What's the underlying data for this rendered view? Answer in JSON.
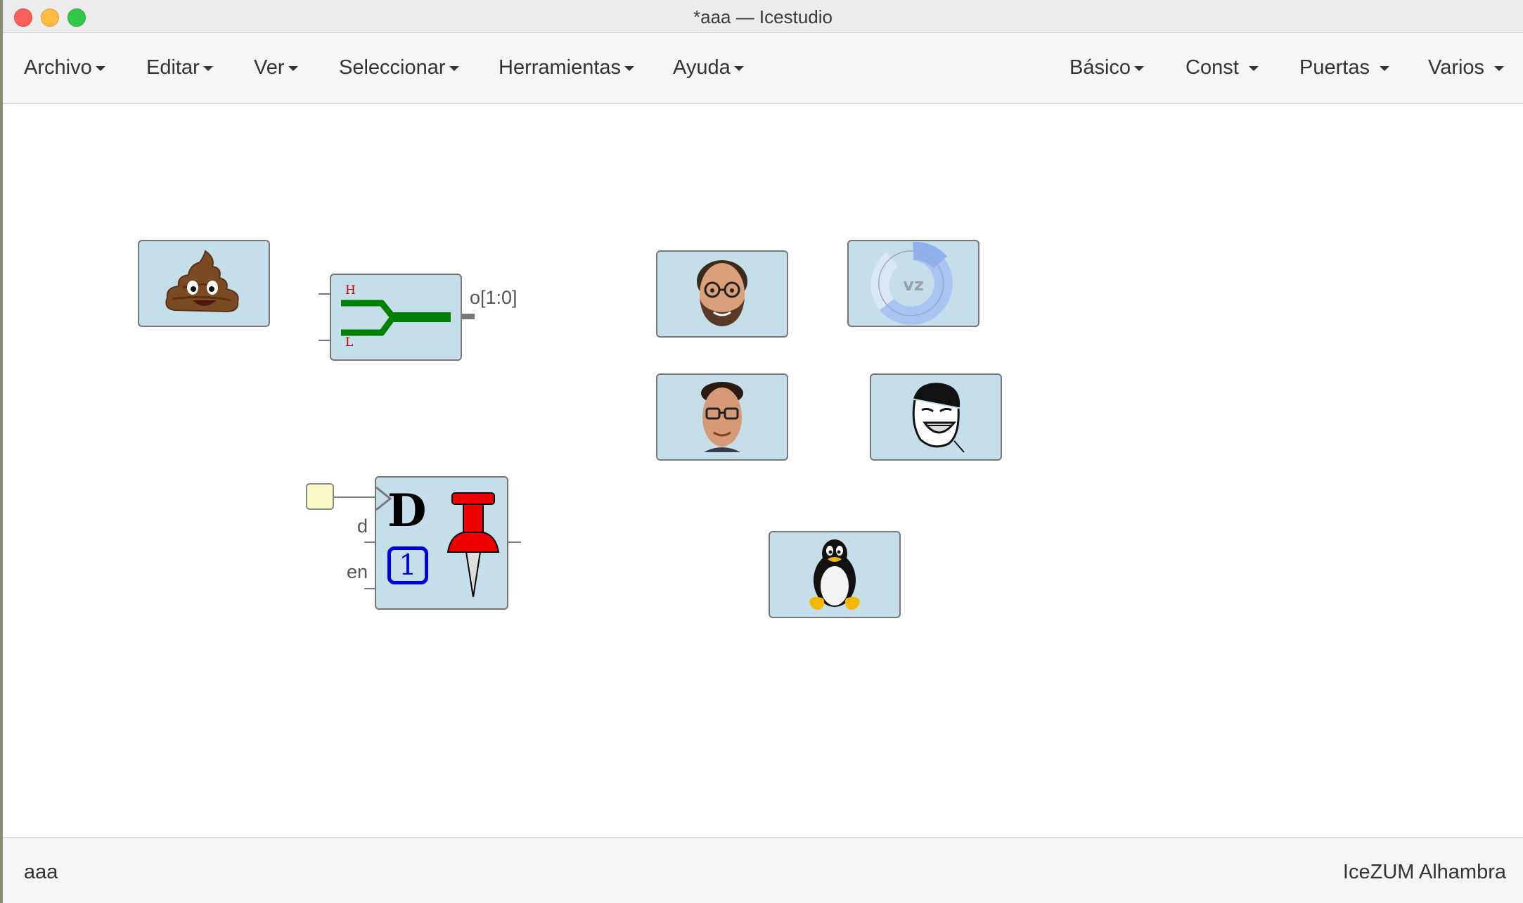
{
  "window": {
    "title": "*aaa — Icestudio"
  },
  "menubar": {
    "left": [
      {
        "label": "Archivo"
      },
      {
        "label": "Editar"
      },
      {
        "label": "Ver"
      },
      {
        "label": "Seleccionar"
      },
      {
        "label": "Herramientas"
      },
      {
        "label": "Ayuda"
      }
    ],
    "right": [
      {
        "label": "Básico"
      },
      {
        "label": "Const"
      },
      {
        "label": "Puertas"
      },
      {
        "label": "Varios"
      }
    ]
  },
  "canvas": {
    "blocks": {
      "poop": {
        "icon": "poop-emoji-icon"
      },
      "combiner": {
        "high_label": "H",
        "low_label": "L",
        "output_label": "o[1:0]",
        "icon": "bus-join-icon"
      },
      "dff": {
        "d_label": "d",
        "en_label": "en",
        "letter": "D",
        "init_value": "1",
        "icon": "pushpin-icon"
      },
      "face1": {
        "icon": "bearded-face-icon"
      },
      "face2": {
        "icon": "glasses-face-icon"
      },
      "puzzle": {
        "icon": "puzzle-ring-icon"
      },
      "meme": {
        "icon": "laughing-meme-face-icon"
      },
      "tux": {
        "icon": "tux-penguin-icon"
      }
    },
    "colors": {
      "block_bg": "#c4dfe9",
      "block_border": "#777777",
      "bus_green": "#008000",
      "label_red": "#cc0000",
      "pin_red": "#ee0000",
      "init_blue": "#0000dd"
    }
  },
  "statusbar": {
    "project": "aaa",
    "board": "IceZUM Alhambra"
  }
}
